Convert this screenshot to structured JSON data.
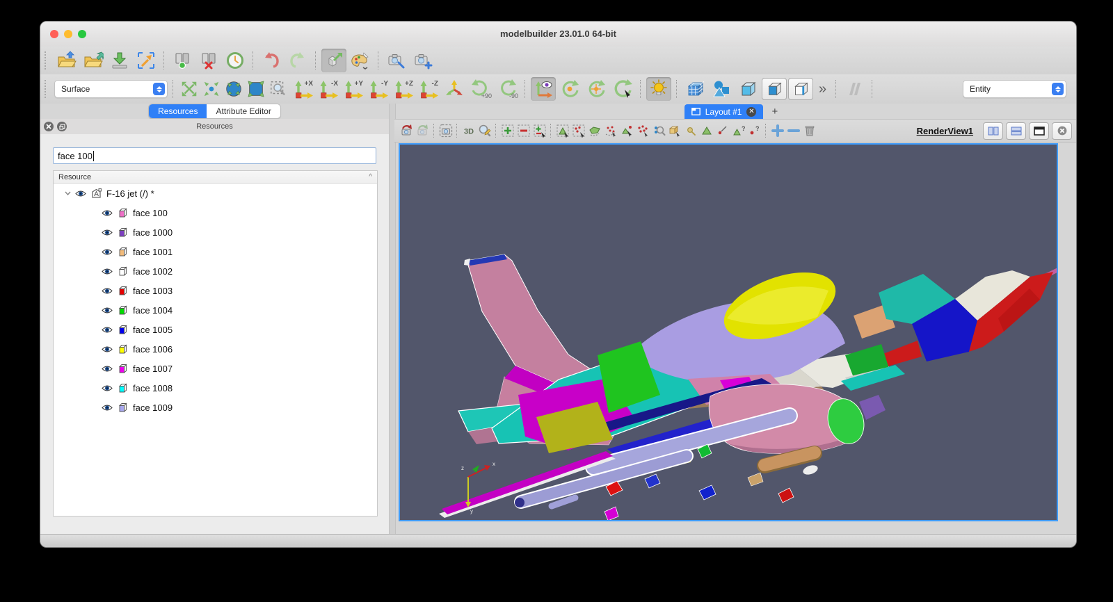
{
  "window": {
    "title": "modelbuilder 23.01.0 64-bit"
  },
  "titlebar": {
    "traffic_lights": [
      {
        "name": "close",
        "color": "#ff5f57"
      },
      {
        "name": "minimize",
        "color": "#febc2e"
      },
      {
        "name": "zoom",
        "color": "#28c840"
      }
    ]
  },
  "toolbar_main": {
    "icons": [
      {
        "name": "open-resource-icon",
        "shape": "yellow folder + blue up arrow"
      },
      {
        "name": "save-resource-icon",
        "shape": "yellow folder + teal import arrow"
      },
      {
        "name": "export-icon",
        "shape": "green down arrow onto tray"
      },
      {
        "name": "zoom-to-selection-icon",
        "shape": "orange arrow + blue dashed corners"
      },
      {
        "name": "connect-server-icon",
        "shape": "server boxes + green dot"
      },
      {
        "name": "disconnect-server-icon",
        "shape": "server boxes + red x"
      },
      {
        "name": "recent-resources-icon",
        "shape": "green clock"
      },
      {
        "name": "undo-icon",
        "shape": "red curved arrow"
      },
      {
        "name": "redo-icon",
        "shape": "green curved arrow"
      },
      {
        "name": "interaction-mode-icon",
        "shape": "cube + green arrow (pressed)"
      },
      {
        "name": "color-palette-icon",
        "shape": "palette + brush + chevron"
      },
      {
        "name": "camera-zoom-icon",
        "shape": "camera + blue magnifier"
      },
      {
        "name": "camera-add-icon",
        "shape": "camera + blue plus"
      }
    ]
  },
  "toolbar_view": {
    "representation": {
      "value": "Surface"
    },
    "axis_buttons": [
      {
        "label": "+X"
      },
      {
        "label": "-X"
      },
      {
        "label": "+Y"
      },
      {
        "label": "-Y"
      },
      {
        "label": "+Z"
      },
      {
        "label": "-Z"
      }
    ],
    "rotate_cw_label": "+90",
    "rotate_ccw_label": "-90",
    "overflow_label": "»",
    "selection_type": {
      "value": "Entity"
    },
    "icons": [
      "expand-view-icon",
      "collapse-view-icon",
      "fit-sphere-icon",
      "fit-box-icon",
      "zoom-box-icon",
      "isometric-view-icon",
      "show-orientation-axes-icon",
      "rotate-camera-icon",
      "rotate-center-icon",
      "rotate-pick-center-icon",
      "toggle-light-icon",
      "multiblock-icon",
      "geometry-shapes-icon",
      "solid-cube-icon",
      "cube-face-icon",
      "cube-edge-icon",
      "slashes-icon"
    ]
  },
  "left_panel": {
    "tabs": [
      {
        "label": "Resources",
        "active": true
      },
      {
        "label": "Attribute Editor",
        "active": false
      }
    ],
    "dock_title": "Resources",
    "search": {
      "value": "face 100"
    },
    "tree": {
      "header": "Resource",
      "sort_indicator": "^",
      "root": {
        "label": "F-16 jet (/) *"
      },
      "items": [
        {
          "label": "face 100",
          "color": "#ef6fc7"
        },
        {
          "label": "face 1000",
          "color": "#7d3fc1"
        },
        {
          "label": "face 1001",
          "color": "#f2bb7b"
        },
        {
          "label": "face 1002",
          "color": "#ffffff"
        },
        {
          "label": "face 1003",
          "color": "#e60000"
        },
        {
          "label": "face 1004",
          "color": "#00dd00"
        },
        {
          "label": "face 1005",
          "color": "#0000ee"
        },
        {
          "label": "face 1006",
          "color": "#ffff00"
        },
        {
          "label": "face 1007",
          "color": "#ee00ee"
        },
        {
          "label": "face 1008",
          "color": "#00ffff"
        },
        {
          "label": "face 1009",
          "color": "#a8a8ee"
        }
      ]
    }
  },
  "layout_area": {
    "tab_label": "Layout #1",
    "new_tab_label": "+",
    "render_toolbar": {
      "mode_3d_label": "3D",
      "question_glyph": "?",
      "icons": [
        "reset-camera-icon",
        "reset-camera-closest-icon",
        "capture-screenshot-icon",
        "toggle-2d3d-icon",
        "zoom-to-data-icon",
        "select-cells-on-icon",
        "deselect-icon",
        "grow-shrink-selection-icon",
        "select-cells-rectangle-icon",
        "select-points-rectangle-icon",
        "select-cells-polygon-icon",
        "select-points-polygon-icon",
        "select-cells-interactive-icon",
        "select-points-cluster-icon",
        "select-blocks-icon",
        "interactive-select-blocks-icon",
        "hover-points-icon",
        "hover-cells-icon",
        "select-point-label-icon",
        "query-cells-icon",
        "query-points-icon",
        "add-view-icon",
        "remove-view-icon",
        "delete-view-icon"
      ]
    },
    "view_title": "RenderView1",
    "view_buttons": [
      "split-horizontal",
      "split-vertical",
      "maximize",
      "close-view"
    ],
    "viewport": {
      "background": "#52566b",
      "model_name": "F-16 jet",
      "axes_labels": {
        "x": "x",
        "y": "y",
        "z": "z"
      }
    }
  },
  "status_bar": {
    "text": ""
  }
}
